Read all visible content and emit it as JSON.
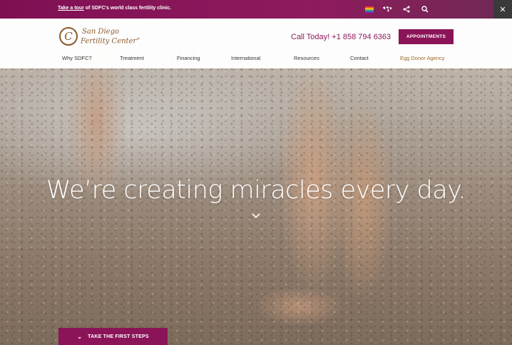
{
  "topbar": {
    "promo_link": "Take a tour",
    "promo_text": " of SDFC's world class fertility clinic.",
    "icons": [
      "rainbow-flag-icon",
      "world-map-icon",
      "share-icon",
      "search-icon"
    ],
    "close_label": "✕"
  },
  "header": {
    "logo_line1": "San Diego",
    "logo_line2": "Fertility Center",
    "logo_trademark": "®",
    "logo_mark": "C",
    "call": "Call Today! +1 858 794 6363",
    "appointments": "APPOINTMENTS",
    "nav": [
      "Why SDFC?",
      "Treatment",
      "Financing",
      "International",
      "Resources",
      "Contact",
      "Egg Donor Agency"
    ]
  },
  "hero": {
    "headline": "We’re creating miracles every day.",
    "cta": "TAKE THE FIRST STEPS"
  },
  "colors": {
    "brand": "#8b1458",
    "logo": "#8b5a2b",
    "accent_nav": "#9a6a2a"
  }
}
